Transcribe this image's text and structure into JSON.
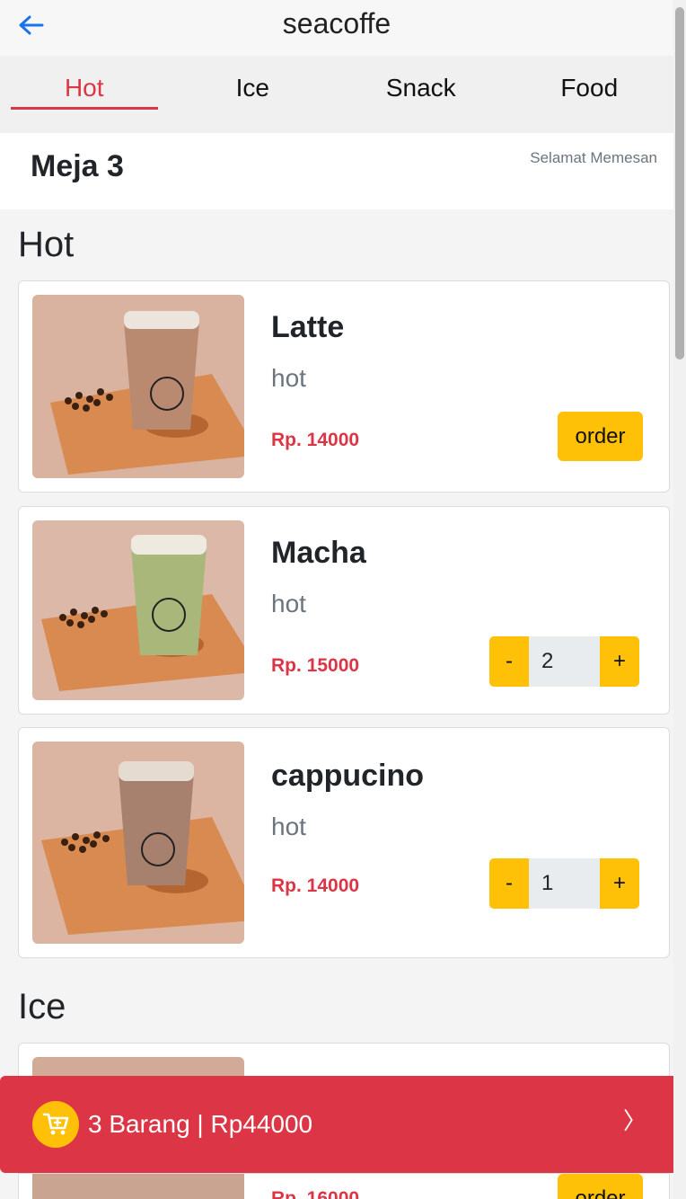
{
  "app": {
    "title": "seacoffe"
  },
  "tabs": [
    {
      "label": "Hot",
      "active": true
    },
    {
      "label": "Ice",
      "active": false
    },
    {
      "label": "Snack",
      "active": false
    },
    {
      "label": "Food",
      "active": false
    }
  ],
  "table": {
    "name": "Meja 3",
    "greeting": "Selamat Memesan"
  },
  "sections": [
    {
      "title": "Hot",
      "items": [
        {
          "name": "Latte",
          "desc": "hot",
          "price": "Rp. 14000",
          "action": "order",
          "order_label": "order"
        },
        {
          "name": "Macha",
          "desc": "hot",
          "price": "Rp. 15000",
          "action": "stepper",
          "qty": "2",
          "minus": "-",
          "plus": "+"
        },
        {
          "name": "cappucino",
          "desc": "hot",
          "price": "Rp. 14000",
          "action": "stepper",
          "qty": "1",
          "minus": "-",
          "plus": "+"
        }
      ]
    },
    {
      "title": "Ice",
      "items": [
        {
          "price": "Rp. 16000",
          "order_label": "order"
        }
      ]
    }
  ],
  "cart": {
    "summary": "3 Barang | Rp44000",
    "chevron": "〉"
  },
  "colors": {
    "accent": "#dc3545",
    "button": "#ffc107",
    "blue": "#1a73e8"
  },
  "icons": {
    "back": "arrow-left-icon",
    "cart": "cart-plus-icon",
    "chevron": "chevron-right-icon"
  }
}
